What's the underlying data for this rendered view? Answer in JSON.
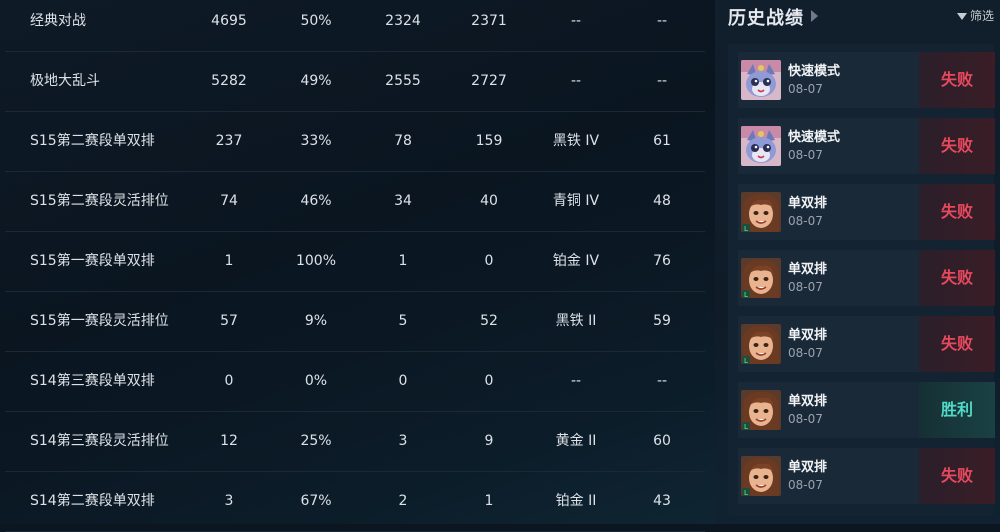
{
  "stats": {
    "rows": [
      {
        "mode": "经典对战",
        "total": "4695",
        "winrate": "50%",
        "wins": "2324",
        "losses": "2371",
        "rank": "--",
        "points": "--"
      },
      {
        "mode": "极地大乱斗",
        "total": "5282",
        "winrate": "49%",
        "wins": "2555",
        "losses": "2727",
        "rank": "--",
        "points": "--"
      },
      {
        "mode": "S15第二赛段单双排",
        "total": "237",
        "winrate": "33%",
        "wins": "78",
        "losses": "159",
        "rank": "黑铁 IV",
        "points": "61"
      },
      {
        "mode": "S15第二赛段灵活排位",
        "total": "74",
        "winrate": "46%",
        "wins": "34",
        "losses": "40",
        "rank": "青铜 IV",
        "points": "48"
      },
      {
        "mode": "S15第一赛段单双排",
        "total": "1",
        "winrate": "100%",
        "wins": "1",
        "losses": "0",
        "rank": "铂金 IV",
        "points": "76"
      },
      {
        "mode": "S15第一赛段灵活排位",
        "total": "57",
        "winrate": "9%",
        "wins": "5",
        "losses": "52",
        "rank": "黑铁 II",
        "points": "59"
      },
      {
        "mode": "S14第三赛段单双排",
        "total": "0",
        "winrate": "0%",
        "wins": "0",
        "losses": "0",
        "rank": "--",
        "points": "--"
      },
      {
        "mode": "S14第三赛段灵活排位",
        "total": "12",
        "winrate": "25%",
        "wins": "3",
        "losses": "9",
        "rank": "黄金 II",
        "points": "60"
      },
      {
        "mode": "S14第二赛段单双排",
        "total": "3",
        "winrate": "67%",
        "wins": "2",
        "losses": "1",
        "rank": "铂金 II",
        "points": "43"
      }
    ]
  },
  "history": {
    "title": "历史战绩",
    "filter_label": "筛选",
    "matches": [
      {
        "mode": "快速模式",
        "date": "08-07",
        "result": "失败",
        "outcome": "lose",
        "avatar": "cat-champion-icon"
      },
      {
        "mode": "快速模式",
        "date": "08-07",
        "result": "失败",
        "outcome": "lose",
        "avatar": "cat-champion-icon"
      },
      {
        "mode": "单双排",
        "date": "08-07",
        "result": "失败",
        "outcome": "lose",
        "avatar": "girl-champion-icon"
      },
      {
        "mode": "单双排",
        "date": "08-07",
        "result": "失败",
        "outcome": "lose",
        "avatar": "girl-champion-icon"
      },
      {
        "mode": "单双排",
        "date": "08-07",
        "result": "失败",
        "outcome": "lose",
        "avatar": "girl-champion-icon"
      },
      {
        "mode": "单双排",
        "date": "08-07",
        "result": "胜利",
        "outcome": "win",
        "avatar": "girl-champion-icon"
      },
      {
        "mode": "单双排",
        "date": "08-07",
        "result": "失败",
        "outcome": "lose",
        "avatar": "girl-champion-icon"
      }
    ]
  },
  "colors": {
    "lose": "#e8495e",
    "win": "#4fd9c6",
    "background": "#0b1621"
  }
}
